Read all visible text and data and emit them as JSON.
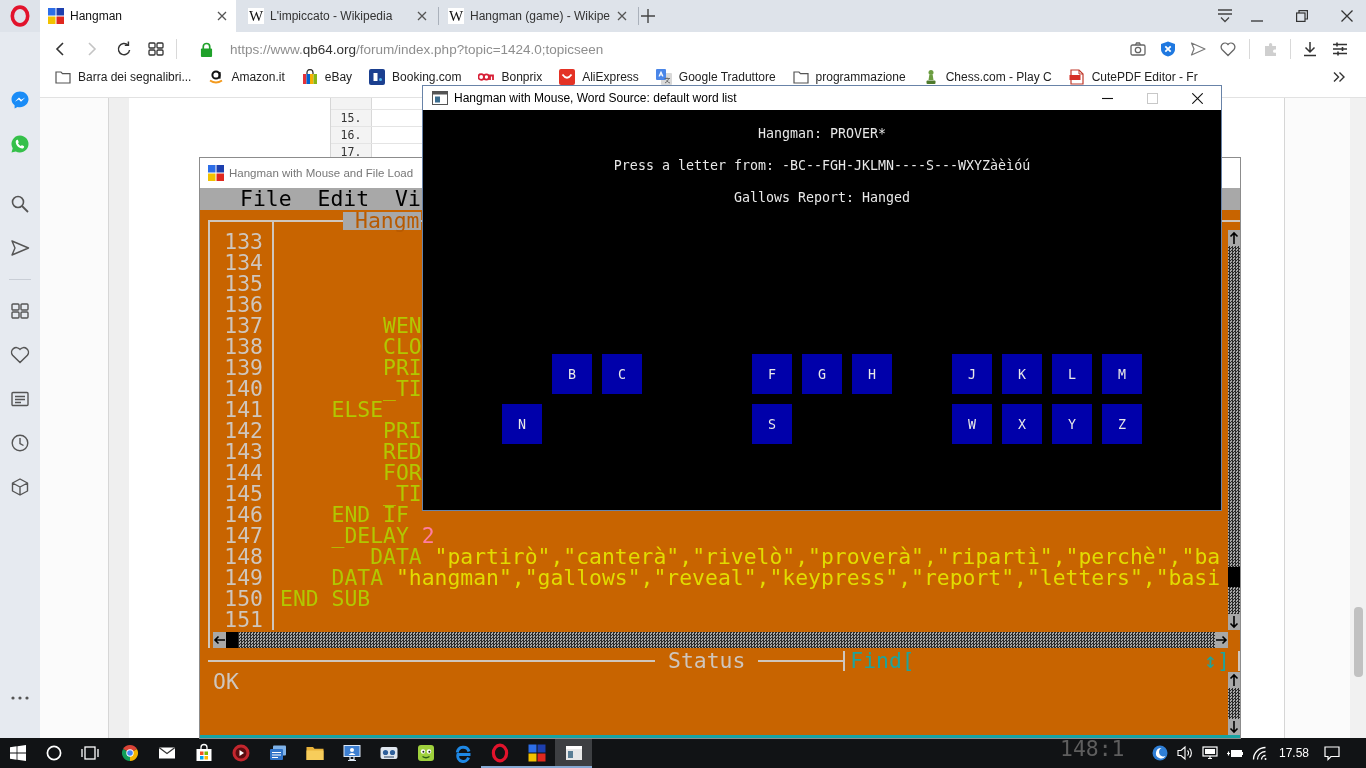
{
  "browser": {
    "tabs": [
      {
        "kind": "app",
        "label": "Hangman",
        "selected": true
      },
      {
        "kind": "letter",
        "icon_text": "W",
        "label": "L'impiccato - Wikipedia",
        "selected": false
      },
      {
        "kind": "letter",
        "icon_text": "W",
        "label": "Hangman (game) - Wikipe",
        "selected": false
      }
    ],
    "forward_disabled": true,
    "url": [
      {
        "kind": "dim",
        "text": "https://www."
      },
      {
        "kind": "host",
        "text": "qb64.org"
      },
      {
        "kind": "dim",
        "text": "/forum/index.php?topic=1424.0;topicseen"
      }
    ],
    "extensions_disabled": true,
    "bookmarks": [
      {
        "kind": "folder",
        "label": "Barra dei segnalibri..."
      },
      {
        "kind": "smile",
        "label": "Amazon.it"
      },
      {
        "kind": "bag",
        "label": "eBay"
      },
      {
        "kind": "blue-tile",
        "label": "Booking.com"
      },
      {
        "kind": "wordmark",
        "label": "Bonprix"
      },
      {
        "kind": "red-tile",
        "label": "AliExpress"
      },
      {
        "kind": "translate",
        "label": "Google Traduttore"
      },
      {
        "kind": "folder",
        "label": "programmazione"
      },
      {
        "kind": "pawn",
        "label": "Chess.com - Play C"
      },
      {
        "kind": "document",
        "label": "CutePDF Editor - Fr"
      }
    ]
  },
  "web_page": {
    "line_numbers": [
      "15.",
      "16.",
      "17."
    ]
  },
  "ide_window": {
    "title": "Hangman with Mouse and File Load",
    "menu": [
      "File",
      "Edit",
      "Vi"
    ],
    "editor_title": "Hangm",
    "lines": [
      {
        "number": "133"
      },
      {
        "number": "134"
      },
      {
        "number": "135"
      },
      {
        "number": "136"
      },
      {
        "number": "137",
        "segments": [
          {
            "kind": "keyword",
            "text": "        WEN"
          }
        ]
      },
      {
        "number": "138",
        "segments": [
          {
            "kind": "keyword",
            "text": "        CLO"
          }
        ]
      },
      {
        "number": "139",
        "segments": [
          {
            "kind": "keyword",
            "text": "        PRI"
          }
        ]
      },
      {
        "number": "140",
        "segments": [
          {
            "kind": "keyword",
            "text": "        _TI"
          }
        ]
      },
      {
        "number": "141",
        "segments": [
          {
            "kind": "keyword",
            "text": "    ELSE"
          }
        ]
      },
      {
        "number": "142",
        "segments": [
          {
            "kind": "keyword",
            "text": "        PRI"
          }
        ]
      },
      {
        "number": "143",
        "segments": [
          {
            "kind": "keyword",
            "text": "        RED"
          }
        ]
      },
      {
        "number": "144",
        "segments": [
          {
            "kind": "keyword",
            "text": "        FOR"
          }
        ]
      },
      {
        "number": "145",
        "segments": [
          {
            "kind": "keyword",
            "text": "        _TI"
          }
        ]
      },
      {
        "number": "146",
        "segments": [
          {
            "kind": "keyword",
            "text": "    END IF"
          }
        ]
      },
      {
        "number": "147",
        "segments": [
          {
            "kind": "keyword",
            "text": "    _DELAY "
          },
          {
            "kind": "number",
            "text": "2"
          }
        ]
      },
      {
        "number": "148",
        "segments": [
          {
            "kind": "keyword",
            "text": "       DATA "
          },
          {
            "kind": "string",
            "text": "\"partirò\",\"canterà\",\"rivelò\",\"proverà\",\"ripartì\",\"perchè\",\"ba"
          }
        ]
      },
      {
        "number": "149",
        "segments": [
          {
            "kind": "keyword",
            "text": "    DATA "
          },
          {
            "kind": "string",
            "text": "\"hangman\",\"gallows\",\"reveal\",\"keypress\",\"report\",\"letters\",\"basi"
          }
        ]
      },
      {
        "number": "150",
        "segments": [
          {
            "kind": "keyword",
            "text": "END SUB"
          }
        ]
      },
      {
        "number": "151"
      }
    ],
    "status_label": "Status",
    "find_label": "Find[",
    "find_end": "↕]",
    "message": "OK",
    "cursor_position": "148:1"
  },
  "hangman_window": {
    "title": "Hangman with Mouse, Word Source: default word list",
    "maximize_disabled": true,
    "lines": [
      "Hangman: PROVER*",
      "Press a letter from: -BC--FGH-JKLMN----S---WXYZàèìóú",
      "Gallows Report: Hanged"
    ],
    "key_rows": [
      [
        {
          "kind": "gap"
        },
        {
          "kind": "key",
          "letter": "B"
        },
        {
          "kind": "key",
          "letter": "C"
        },
        {
          "kind": "gap"
        },
        {
          "kind": "gap"
        },
        {
          "kind": "key",
          "letter": "F"
        },
        {
          "kind": "key",
          "letter": "G"
        },
        {
          "kind": "key",
          "letter": "H"
        },
        {
          "kind": "gap"
        },
        {
          "kind": "key",
          "letter": "J"
        },
        {
          "kind": "key",
          "letter": "K"
        },
        {
          "kind": "key",
          "letter": "L"
        },
        {
          "kind": "key",
          "letter": "M"
        }
      ],
      [
        {
          "kind": "key",
          "letter": "N"
        },
        {
          "kind": "gap"
        },
        {
          "kind": "gap"
        },
        {
          "kind": "gap"
        },
        {
          "kind": "gap"
        },
        {
          "kind": "key",
          "letter": "S"
        },
        {
          "kind": "gap"
        },
        {
          "kind": "gap"
        },
        {
          "kind": "gap"
        },
        {
          "kind": "key",
          "letter": "W"
        },
        {
          "kind": "key",
          "letter": "X"
        },
        {
          "kind": "key",
          "letter": "Y"
        },
        {
          "kind": "key",
          "letter": "Z"
        }
      ]
    ]
  },
  "taskbar": {
    "apps": [
      {
        "kind": "ball",
        "running": false,
        "selected": false
      },
      {
        "kind": "envelope",
        "running": false,
        "selected": false
      },
      {
        "kind": "bag",
        "running": false,
        "selected": false
      },
      {
        "kind": "disc",
        "running": false,
        "selected": false
      },
      {
        "kind": "stack",
        "running": false,
        "selected": false
      },
      {
        "kind": "folder",
        "running": false,
        "selected": false
      },
      {
        "kind": "monitor",
        "running": false,
        "selected": false
      },
      {
        "kind": "cassette",
        "running": false,
        "selected": false
      },
      {
        "kind": "face",
        "running": false,
        "selected": false
      },
      {
        "kind": "swirl",
        "running": false,
        "selected": false
      },
      {
        "kind": "ring",
        "running": true,
        "selected": false
      },
      {
        "kind": "squares",
        "running": true,
        "selected": false
      },
      {
        "kind": "window",
        "running": true,
        "selected": true
      }
    ],
    "clock": "17.58"
  }
}
